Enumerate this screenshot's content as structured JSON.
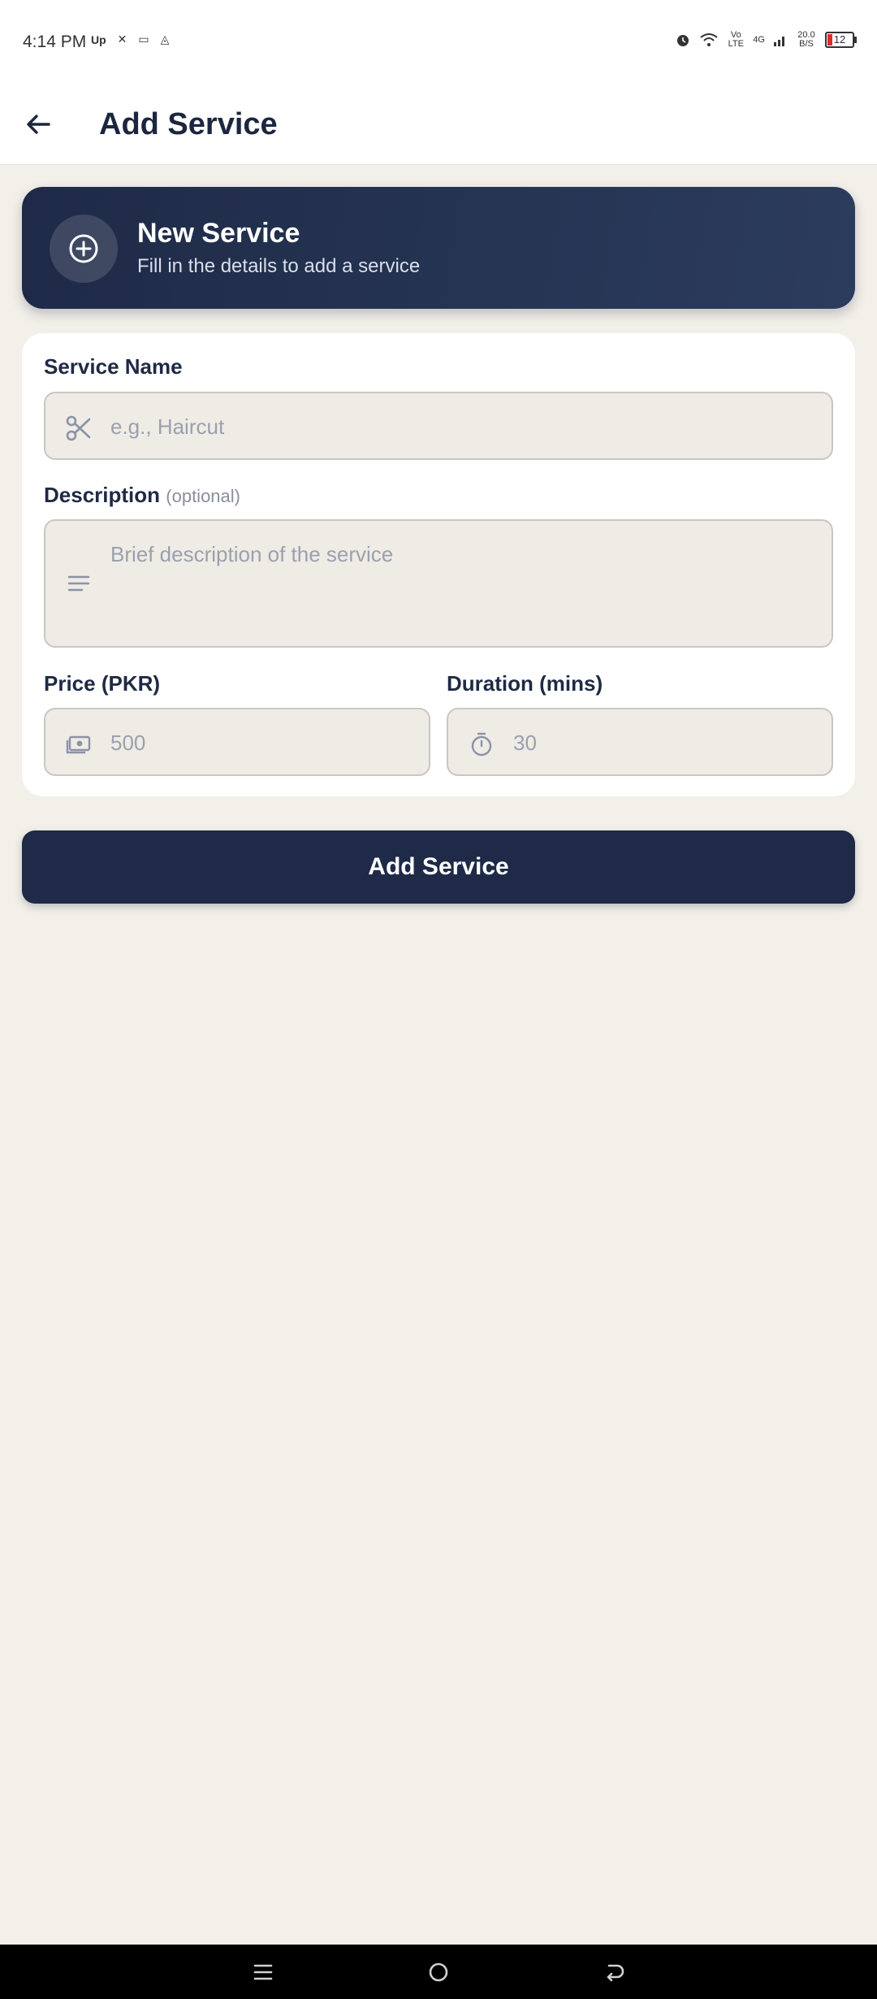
{
  "status_bar": {
    "time": "4:14 PM",
    "left_icons": [
      "Up",
      "✕",
      "▭",
      "◬"
    ],
    "volte": "Vo LTE",
    "network": "4G",
    "speed": "20.0 B/S",
    "battery": "12"
  },
  "app_bar": {
    "title": "Add Service",
    "back_icon": "arrow-left-icon"
  },
  "hero": {
    "title": "New Service",
    "subtitle": "Fill in the details to add a service",
    "icon": "plus-circle-icon"
  },
  "form": {
    "service_name": {
      "label": "Service Name",
      "placeholder": "e.g., Haircut",
      "icon": "scissors-icon"
    },
    "description": {
      "label": "Description",
      "optional": "(optional)",
      "placeholder": "Brief description of the service",
      "icon": "lines-icon"
    },
    "price": {
      "label": "Price (PKR)",
      "placeholder": "500",
      "icon": "cash-icon"
    },
    "duration": {
      "label": "Duration (mins)",
      "placeholder": "30",
      "icon": "timer-icon"
    }
  },
  "submit": {
    "label": "Add Service"
  },
  "colors": {
    "primary": "#1e2a47",
    "background": "#f3efe9",
    "field_bg": "#efebe5",
    "placeholder": "#9aa1ae"
  }
}
